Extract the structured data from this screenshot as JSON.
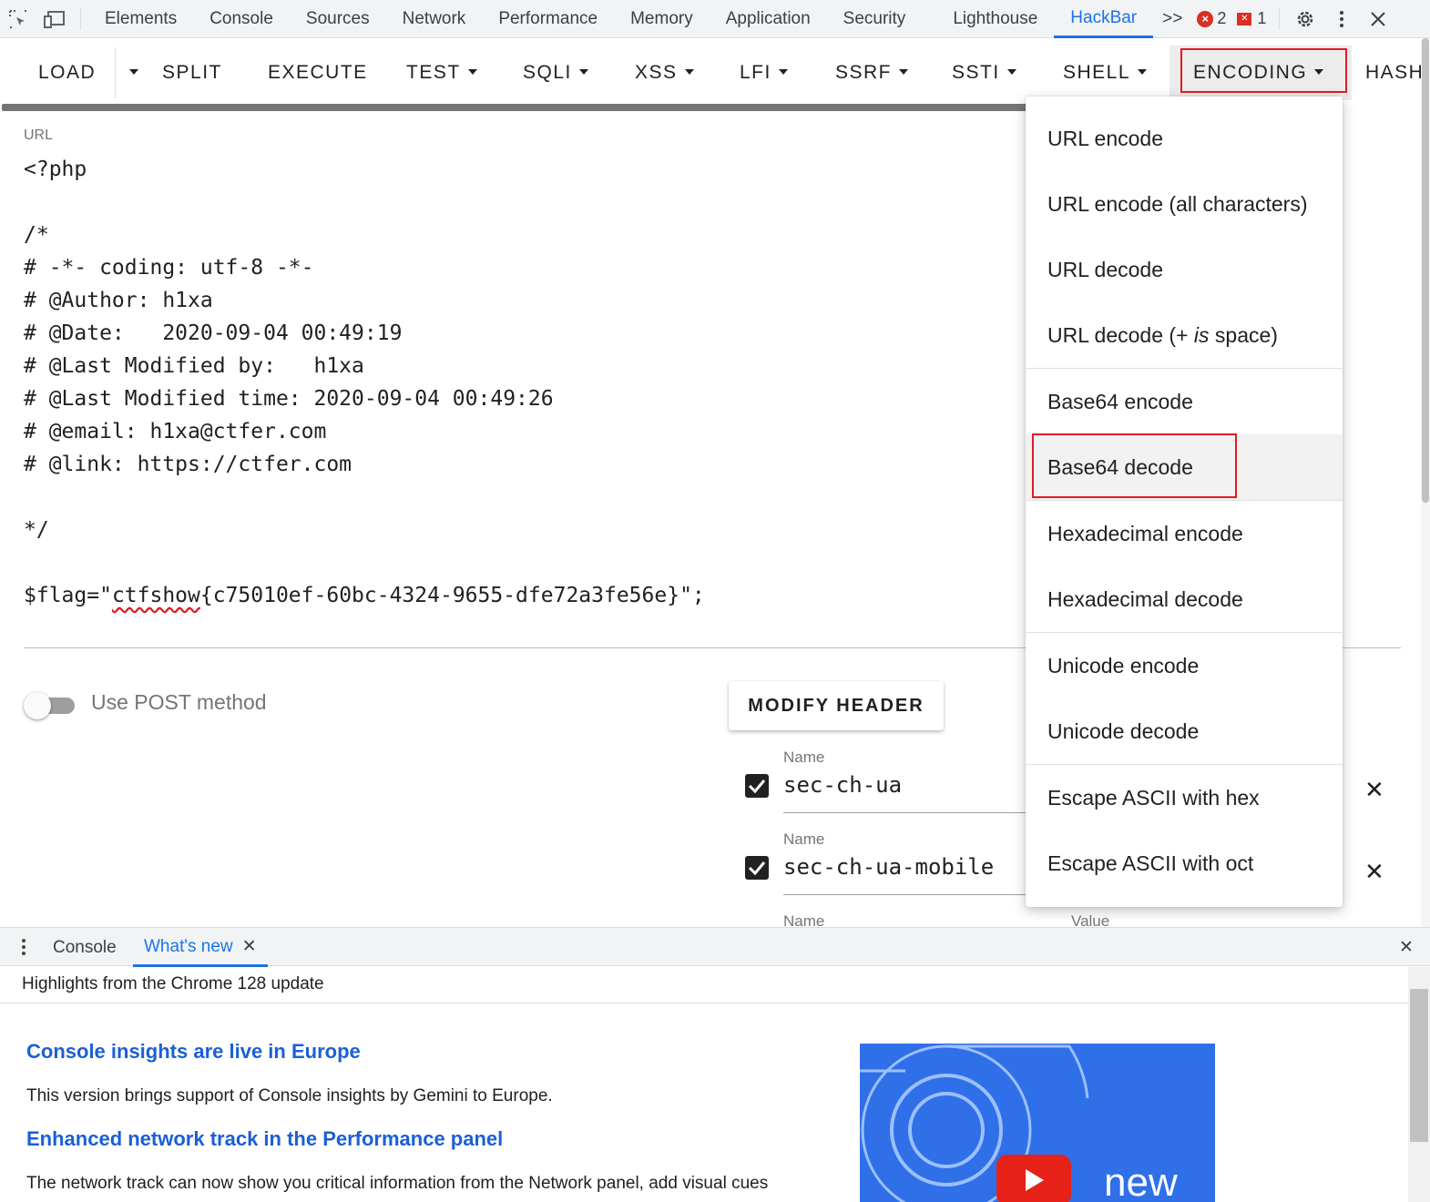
{
  "devtools": {
    "tabs": [
      "Elements",
      "Console",
      "Sources",
      "Network",
      "Performance",
      "Memory",
      "Application",
      "Security",
      "Lighthouse",
      "HackBar"
    ],
    "active_tab": "HackBar",
    "more_tabs": ">>",
    "error_count": "2",
    "issue_count": "1"
  },
  "hackbar": {
    "toolbar": {
      "load": "LOAD",
      "split": "SPLIT",
      "execute": "EXECUTE",
      "test": "TEST",
      "sqli": "SQLI",
      "xss": "XSS",
      "lfi": "LFI",
      "ssrf": "SSRF",
      "ssti": "SSTI",
      "shell": "SHELL",
      "encoding": "ENCODING",
      "hash": "HASH"
    },
    "url_label": "URL",
    "code_lines": [
      "<?php",
      "",
      "/*",
      "# -*- coding: utf-8 -*-",
      "# @Author: h1xa",
      "# @Date:   2020-09-04 00:49:19",
      "# @Last Modified by:   h1xa",
      "# @Last Modified time: 2020-09-04 00:49:26",
      "# @email: h1xa@ctfer.com",
      "# @link: https://ctfer.com",
      "",
      "*/",
      ""
    ],
    "flag_prefix": "$flag=\"",
    "flag_word": "ctfshow",
    "flag_rest": "{c75010ef-60bc-4324-9655-dfe72a3fe56e}\";",
    "post_toggle_label": "Use POST method",
    "modify_header_label": "MODIFY HEADER",
    "headers": [
      {
        "name_label": "Name",
        "value": "sec-ch-ua"
      },
      {
        "name_label": "Name",
        "value": "sec-ch-ua-mobile"
      },
      {
        "name_label": "Name",
        "value_label": "Value"
      }
    ],
    "encoding_menu": [
      "URL encode",
      "URL encode (all characters)",
      "URL decode",
      "URL decode (+ is space)",
      "Base64 encode",
      "Base64 decode",
      "Hexadecimal encode",
      "Hexadecimal decode",
      "Unicode encode",
      "Unicode decode",
      "Escape ASCII with hex",
      "Escape ASCII with oct"
    ],
    "url_decode_plus_parts": [
      "URL decode (+ ",
      "is",
      " space)"
    ],
    "highlighted_item": "Base64 decode"
  },
  "drawer": {
    "tabs": [
      "Console",
      "What's new"
    ],
    "active_tab": "What's new",
    "highlights": "Highlights from the Chrome 128 update",
    "sections": [
      {
        "heading": "Console insights are live in Europe",
        "text": "This version brings support of Console insights by Gemini to Europe."
      },
      {
        "heading": "Enhanced network track in the Performance panel",
        "text": "The network track can now show you critical information from the Network panel, add visual cues"
      }
    ],
    "video_label": "new"
  },
  "colors": {
    "accent": "#1a73e8",
    "highlight_box": "#e01b24",
    "heading_link": "#1a5fd6"
  }
}
